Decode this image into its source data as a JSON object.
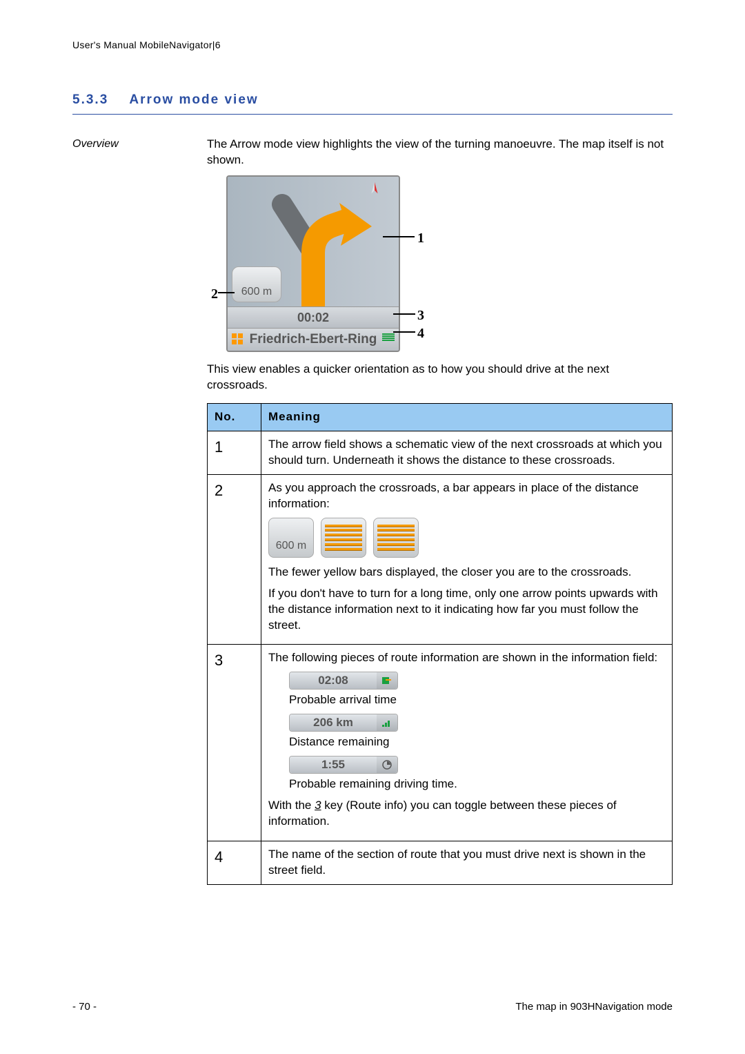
{
  "header": "User's Manual MobileNavigator|6",
  "section": {
    "number": "5.3.3",
    "title": "Arrow mode view"
  },
  "overview_label": "Overview",
  "overview_p1": "The Arrow mode view highlights the view of the turning manoeuvre. The map itself is not shown.",
  "overview_p2": "This view enables a quicker orientation as to how you should drive at the next crossroads.",
  "figure": {
    "distance": "600 m",
    "time": "00:02",
    "street": "Friedrich-Ebert-Ring",
    "callouts": {
      "c1": "1",
      "c2": "2",
      "c3": "3",
      "c4": "4"
    }
  },
  "table": {
    "head_no": "No.",
    "head_meaning": "Meaning",
    "rows": [
      {
        "no": "1",
        "text": "The arrow field shows a schematic view of the next crossroads at which you should turn. Underneath it shows the distance to these crossroads."
      },
      {
        "no": "2",
        "p1": "As you approach the crossroads, a bar appears in place of the distance information:",
        "dist": "600 m",
        "p2": "The fewer yellow bars displayed, the closer you are to the crossroads.",
        "p3": "If you don't have to turn for a long time, only one arrow points upwards with the distance information next to it indicating how far you must follow the street."
      },
      {
        "no": "3",
        "p1": "The following pieces of route information are shown in the information field:",
        "pill1": "02:08",
        "lbl1": "Probable arrival time",
        "pill2": "206 km",
        "lbl2": "Distance remaining",
        "pill3": "1:55",
        "lbl3": "Probable remaining driving time.",
        "p2a": "With the ",
        "p2key": "3",
        "p2b": " key (Route info) you can toggle between these pieces of information."
      },
      {
        "no": "4",
        "text": "The name of the section of route that you must drive next is shown in the street field."
      }
    ]
  },
  "footer": {
    "left": "- 70 -",
    "right": "The map in 903HNavigation mode"
  }
}
